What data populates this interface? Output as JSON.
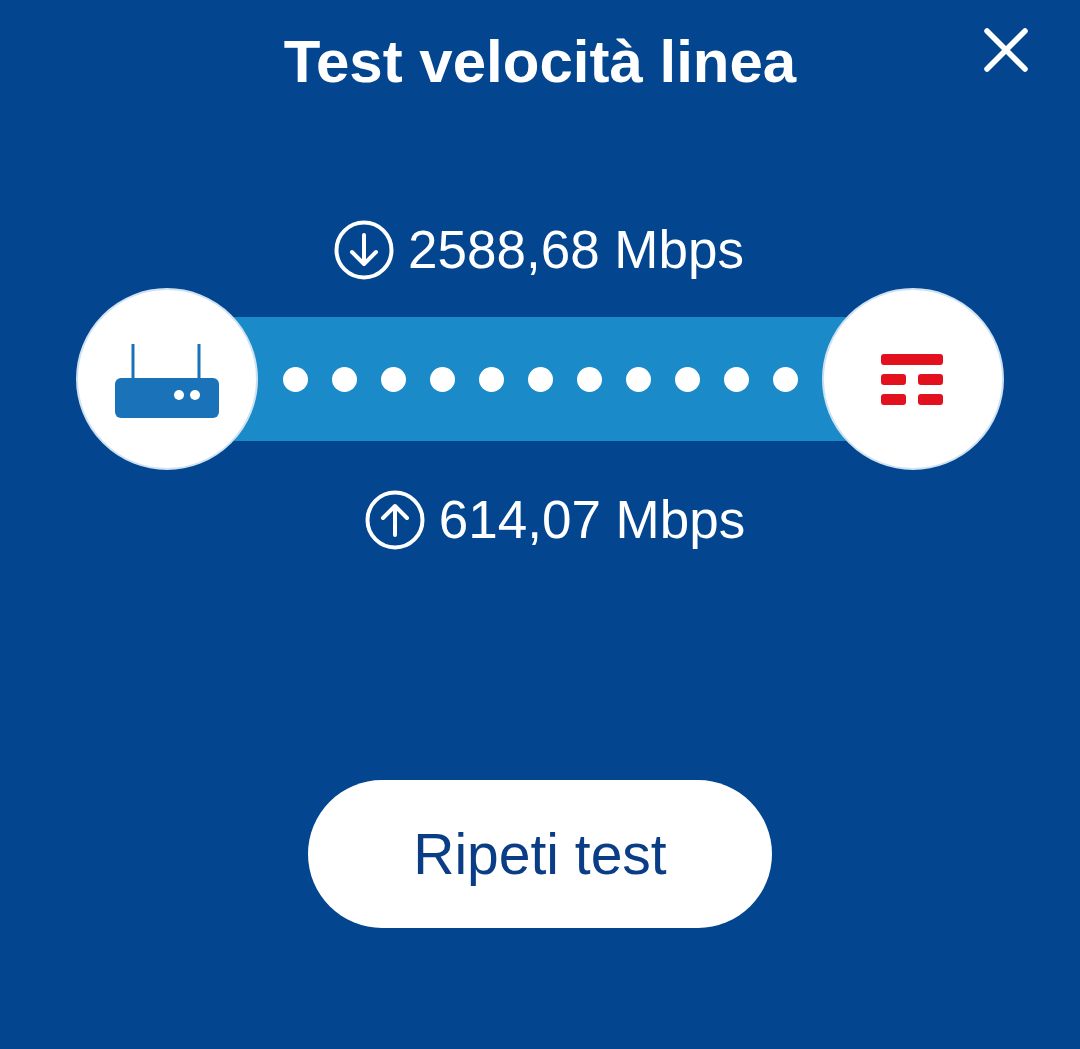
{
  "header": {
    "title": "Test velocità linea"
  },
  "download": {
    "value": "2588,68 Mbps"
  },
  "upload": {
    "value": "614,07 Mbps"
  },
  "button": {
    "label": "Ripeti test"
  }
}
